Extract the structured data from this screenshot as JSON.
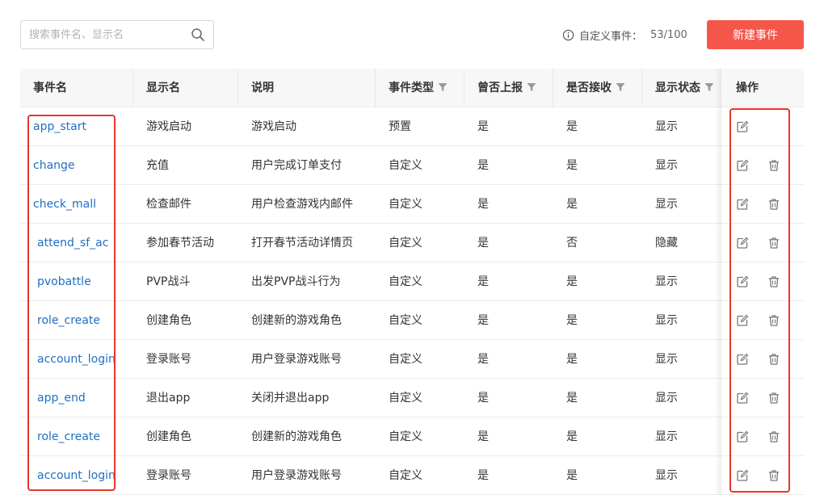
{
  "search": {
    "placeholder": "搜索事件名、显示名",
    "icon": "search-icon"
  },
  "quota": {
    "icon": "info-icon",
    "label": "自定义事件：",
    "count": "53/100"
  },
  "new_button": {
    "label": "新建事件"
  },
  "table": {
    "columns": [
      {
        "label": "事件名",
        "filter": false
      },
      {
        "label": "显示名",
        "filter": false
      },
      {
        "label": "说明",
        "filter": false
      },
      {
        "label": "事件类型",
        "filter": true
      },
      {
        "label": "曾否上报",
        "filter": true
      },
      {
        "label": "是否接收",
        "filter": true
      },
      {
        "label": "显示状态",
        "filter": true
      }
    ],
    "actions_header": "操作",
    "rows": [
      {
        "event": "app_start",
        "display": "游戏启动",
        "desc": "游戏启动",
        "type": "预置",
        "reported": "是",
        "received": "是",
        "status": "显示",
        "deletable": false
      },
      {
        "event": "change",
        "display": "充值",
        "desc": "用户完成订单支付",
        "type": "自定义",
        "reported": "是",
        "received": "是",
        "status": "显示",
        "deletable": true
      },
      {
        "event": "check_mall",
        "display": "检查邮件",
        "desc": "用户检查游戏内邮件",
        "type": "自定义",
        "reported": "是",
        "received": "是",
        "status": "显示",
        "deletable": true
      },
      {
        "event": "attend_sf_ac",
        "display": "参加春节活动",
        "desc": "打开春节活动详情页",
        "type": "自定义",
        "reported": "是",
        "received": "否",
        "status": "隐藏",
        "deletable": true
      },
      {
        "event": "pvobattle",
        "display": "PVP战斗",
        "desc": "出发PVP战斗行为",
        "type": "自定义",
        "reported": "是",
        "received": "是",
        "status": "显示",
        "deletable": true
      },
      {
        "event": "role_create",
        "display": "创建角色",
        "desc": "创建新的游戏角色",
        "type": "自定义",
        "reported": "是",
        "received": "是",
        "status": "显示",
        "deletable": true
      },
      {
        "event": "account_login",
        "display": "登录账号",
        "desc": "用户登录游戏账号",
        "type": "自定义",
        "reported": "是",
        "received": "是",
        "status": "显示",
        "deletable": true
      },
      {
        "event": "app_end",
        "display": "退出app",
        "desc": "关闭并退出app",
        "type": "自定义",
        "reported": "是",
        "received": "是",
        "status": "显示",
        "deletable": true
      },
      {
        "event": "role_create",
        "display": "创建角色",
        "desc": "创建新的游戏角色",
        "type": "自定义",
        "reported": "是",
        "received": "是",
        "status": "显示",
        "deletable": true
      },
      {
        "event": "account_login",
        "display": "登录账号",
        "desc": "用户登录游戏账号",
        "type": "自定义",
        "reported": "是",
        "received": "是",
        "status": "显示",
        "deletable": true
      }
    ]
  },
  "icons": {
    "edit": "edit-icon",
    "delete": "trash-icon",
    "filter": "filter-icon"
  },
  "colors": {
    "primary_button": "#f5564a",
    "link": "#1f6fc2",
    "highlight_box": "#e8372c"
  }
}
